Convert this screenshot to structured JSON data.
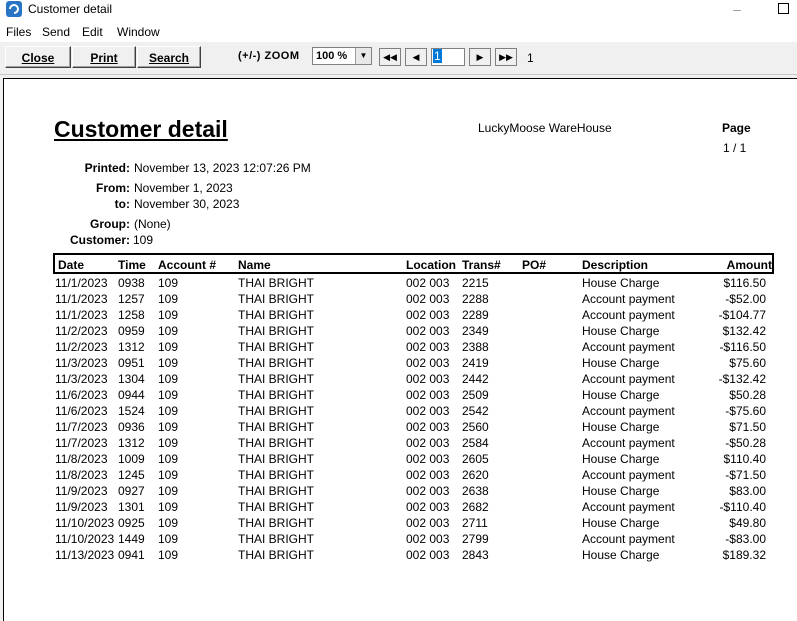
{
  "window": {
    "title": "Customer detail"
  },
  "menu": [
    "Files",
    "Send",
    "Edit",
    "Window"
  ],
  "toolbar": {
    "close_label": "Close",
    "close_key": "C",
    "print_label": "Print",
    "print_key": "P",
    "search_label": "Search",
    "search_key": "S",
    "zoom_label": "(+/-) ZOOM",
    "zoom_value": "100 %",
    "page_input": "1",
    "page_total": "1"
  },
  "report": {
    "title": "Customer detail",
    "company": "LuckyMoose WareHouse",
    "page_label": "Page",
    "page_value": "1 / 1",
    "printed_label": "Printed:",
    "printed_value": "November 13, 2023 12:07:26 PM",
    "from_label": "From:",
    "from_value": "November 1, 2023",
    "to_label": "to:",
    "to_value": "November 30, 2023",
    "group_label": "Group:",
    "group_value": "(None)",
    "customer_label": "Customer:",
    "customer_value": "109"
  },
  "table": {
    "headers": {
      "date": "Date",
      "time": "Time",
      "account": "Account #",
      "name": "Name",
      "location": "Location",
      "trans": "Trans#",
      "po": "PO#",
      "description": "Description",
      "amount": "Amount"
    },
    "rows": [
      {
        "date": "11/1/2023",
        "time": "0938",
        "account": "109",
        "name": "THAI BRIGHT",
        "location": "002 003",
        "trans": "2215",
        "description": "House Charge",
        "amount": "$116.50"
      },
      {
        "date": "11/1/2023",
        "time": "1257",
        "account": "109",
        "name": "THAI BRIGHT",
        "location": "002 003",
        "trans": "2288",
        "description": "Account payment",
        "amount": "-$52.00"
      },
      {
        "date": "11/1/2023",
        "time": "1258",
        "account": "109",
        "name": "THAI BRIGHT",
        "location": "002 003",
        "trans": "2289",
        "description": "Account payment",
        "amount": "-$104.77"
      },
      {
        "date": "11/2/2023",
        "time": "0959",
        "account": "109",
        "name": "THAI BRIGHT",
        "location": "002 003",
        "trans": "2349",
        "description": "House Charge",
        "amount": "$132.42"
      },
      {
        "date": "11/2/2023",
        "time": "1312",
        "account": "109",
        "name": "THAI BRIGHT",
        "location": "002 003",
        "trans": "2388",
        "description": "Account payment",
        "amount": "-$116.50"
      },
      {
        "date": "11/3/2023",
        "time": "0951",
        "account": "109",
        "name": "THAI BRIGHT",
        "location": "002 003",
        "trans": "2419",
        "description": "House Charge",
        "amount": "$75.60"
      },
      {
        "date": "11/3/2023",
        "time": "1304",
        "account": "109",
        "name": "THAI BRIGHT",
        "location": "002 003",
        "trans": "2442",
        "description": "Account payment",
        "amount": "-$132.42"
      },
      {
        "date": "11/6/2023",
        "time": "0944",
        "account": "109",
        "name": "THAI BRIGHT",
        "location": "002 003",
        "trans": "2509",
        "description": "House Charge",
        "amount": "$50.28"
      },
      {
        "date": "11/6/2023",
        "time": "1524",
        "account": "109",
        "name": "THAI BRIGHT",
        "location": "002 003",
        "trans": "2542",
        "description": "Account payment",
        "amount": "-$75.60"
      },
      {
        "date": "11/7/2023",
        "time": "0936",
        "account": "109",
        "name": "THAI BRIGHT",
        "location": "002 003",
        "trans": "2560",
        "description": "House Charge",
        "amount": "$71.50"
      },
      {
        "date": "11/7/2023",
        "time": "1312",
        "account": "109",
        "name": "THAI BRIGHT",
        "location": "002 003",
        "trans": "2584",
        "description": "Account payment",
        "amount": "-$50.28"
      },
      {
        "date": "11/8/2023",
        "time": "1009",
        "account": "109",
        "name": "THAI BRIGHT",
        "location": "002 003",
        "trans": "2605",
        "description": "House Charge",
        "amount": "$110.40"
      },
      {
        "date": "11/8/2023",
        "time": "1245",
        "account": "109",
        "name": "THAI BRIGHT",
        "location": "002 003",
        "trans": "2620",
        "description": "Account payment",
        "amount": "-$71.50"
      },
      {
        "date": "11/9/2023",
        "time": "0927",
        "account": "109",
        "name": "THAI BRIGHT",
        "location": "002 003",
        "trans": "2638",
        "description": "House Charge",
        "amount": "$83.00"
      },
      {
        "date": "11/9/2023",
        "time": "1301",
        "account": "109",
        "name": "THAI BRIGHT",
        "location": "002 003",
        "trans": "2682",
        "description": "Account payment",
        "amount": "-$110.40"
      },
      {
        "date": "11/10/2023",
        "time": "0925",
        "account": "109",
        "name": "THAI BRIGHT",
        "location": "002 003",
        "trans": "2711",
        "description": "House Charge",
        "amount": "$49.80"
      },
      {
        "date": "11/10/2023",
        "time": "1449",
        "account": "109",
        "name": "THAI BRIGHT",
        "location": "002 003",
        "trans": "2799",
        "description": "Account payment",
        "amount": "-$83.00"
      },
      {
        "date": "11/13/2023",
        "time": "0941",
        "account": "109",
        "name": "THAI BRIGHT",
        "location": "002 003",
        "trans": "2843",
        "description": "House Charge",
        "amount": "$189.32"
      }
    ]
  }
}
